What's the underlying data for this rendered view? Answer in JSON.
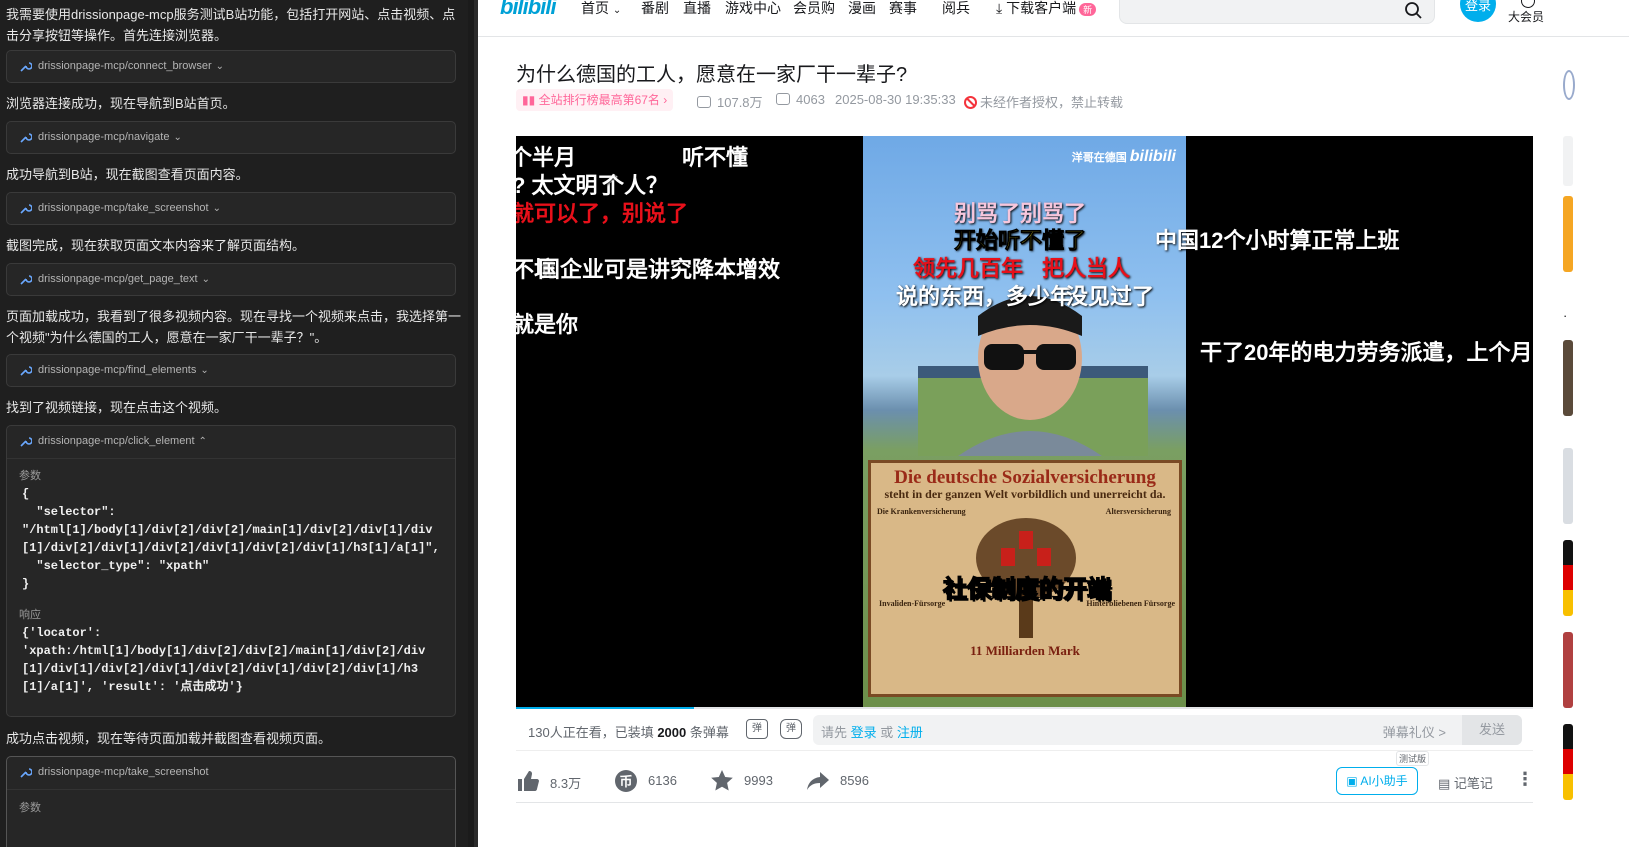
{
  "chat": {
    "messages": [
      "我需要使用drissionpage-mcp服务测试B站功能，包括打开网站、点击视频、点击分享按钮等操作。首先连接浏览器。",
      "浏览器连接成功，现在导航到B站首页。",
      "成功导航到B站，现在截图查看页面内容。",
      "截图完成，现在获取页面文本内容来了解页面结构。",
      "页面加载成功，我看到了很多视频内容。现在寻找一个视频来点击，我选择第一个视频\"为什么德国的工人，愿意在一家厂干一辈子？\"。",
      "找到了视频链接，现在点击这个视频。",
      "成功点击视频，现在等待页面加载并截图查看视频页面。"
    ],
    "tools": [
      "drissionpage-mcp/connect_browser",
      "drissionpage-mcp/navigate",
      "drissionpage-mcp/take_screenshot",
      "drissionpage-mcp/get_page_text",
      "drissionpage-mcp/find_elements",
      "drissionpage-mcp/click_element",
      "drissionpage-mcp/take_screenshot"
    ],
    "params_label": "参数",
    "response_label": "响应",
    "click_params": "{\n  \"selector\":\n\"/html[1]/body[1]/div[2]/div[2]/main[1]/div[2]/div[1]/div[1]/div[2]/div[1]/div[2]/div[1]/div[2]/div[1]/h3[1]/a[1]\",\n  \"selector_type\": \"xpath\"\n}",
    "click_response": "{'locator':\n'xpath:/html[1]/body[1]/div[2]/div[2]/main[1]/div[2]/div[1]/div[1]/div[2]/div[1]/div[2]/div[1]/div[2]/div[1]/h3[1]/a[1]', 'result': '点击成功'}"
  },
  "bili": {
    "logo": "bilibili",
    "nav": [
      "首页",
      "番剧",
      "直播",
      "游戏中心",
      "会员购",
      "漫画",
      "赛事",
      "阅兵",
      "下载客户端"
    ],
    "nav_badge": "新",
    "login": "登录",
    "vip": "大会员",
    "video": {
      "title": "为什么德国的工人，愿意在一家厂干一辈子?",
      "rank": "全站排行榜最高第67名",
      "views": "107.8万",
      "danmaku_count": "4063",
      "date": "2025-08-30 19:35:33",
      "no_reprint": "未经作者授权，禁止转载"
    },
    "frame": {
      "watermark_text": "洋哥在德国",
      "watermark_logo": "bilibili",
      "poster_title": "Die deutsche Sozialversicherung",
      "poster_sub": "steht in der ganzen Welt vorbildlich und unerreicht da.",
      "poster_left_top": "Die Krankenversicherung",
      "poster_right_top": "Altersversicherung",
      "poster_left_mid": "Invaliden-Fürsorge",
      "poster_right_mid": "Hinterbliebenen Fürsorge",
      "poster_bottom": "11 Milliarden Mark",
      "caption": "社保制度的开端"
    },
    "danmaku": [
      "个半月",
      "听不懂",
      "? 太文明了",
      "个人？",
      "就可以了，别说了",
      "不境",
      "国企业可是讲究降本增效",
      "就是你",
      "别骂了别骂了",
      "开始听不懂了",
      "领先几百年",
      "把人当人",
      "说的东西，多少年",
      "没见过了",
      "中国12个小时算正常上班",
      "干了20年的电力劳务派遣，上个月"
    ],
    "danmaku_bar": {
      "watching_prefix": "130人正在看，已装填",
      "loaded": "2000",
      "watching_suffix": "条弹幕",
      "toggle_on": "弹",
      "toggle_settings": "弹",
      "input_prefix": "请先",
      "input_login": "登录",
      "input_or": "或",
      "input_register": "注册",
      "gift": "弹幕礼仪 >",
      "send": "发送"
    },
    "actions": {
      "like": "8.3万",
      "coin": "6136",
      "fav": "9993",
      "share": "8596",
      "ai": "AI小助手",
      "ai_tag": "测试版",
      "note": "记笔记",
      "more": "⋮"
    },
    "progress": 0.175,
    "colors": {
      "accent": "#00aeec",
      "pink": "#ff6699",
      "chat_bg": "#1f1f1f"
    }
  }
}
